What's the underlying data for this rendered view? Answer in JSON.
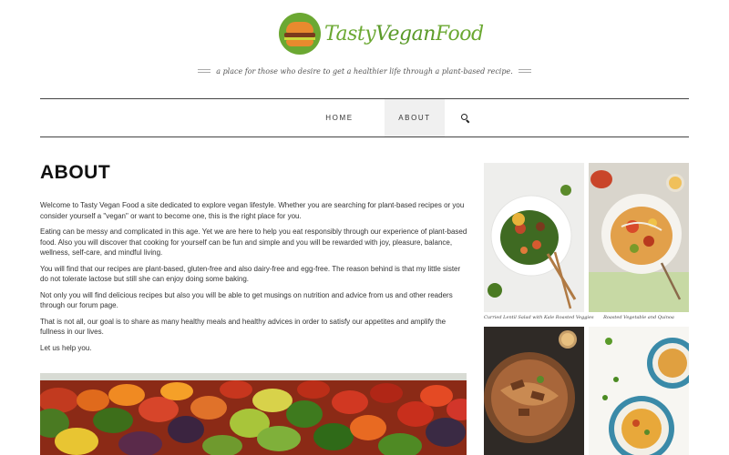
{
  "site": {
    "logo_text_tasty": "Tasty",
    "logo_text_vegan": "Vegan",
    "logo_text_food": "Food",
    "tagline": "a place for those who desire to get a healthier life through a plant-based recipe.",
    "brand_color": "#6ba832"
  },
  "nav": {
    "items": [
      {
        "label": "HOME",
        "active": false
      },
      {
        "label": "ABOUT",
        "active": true
      }
    ],
    "search_icon": "search-icon"
  },
  "main": {
    "title": "ABOUT",
    "paragraphs": [
      "Welcome to Tasty Vegan Food a site dedicated to explore vegan lifestyle. Whether you are searching for plant-based recipes or you consider yourself a \"vegan\" or want to become one, this is the right place for you.",
      "Eating can be messy and complicated in this age. Yet we are here to help you eat responsibly through our experience of plant-based food. Also you will discover that cooking for yourself can be fun and simple and you will be rewarded with joy, pleasure, balance, wellness, self-care, and mindful living.",
      "You will find that our recipes are plant-based, gluten-free and also dairy-free and egg-free. The reason behind is that my little sister do not tolerate lactose but still she can enjoy doing some baking.",
      "Not only you will find delicious recipes but also you will be able to get musings on nutrition and advice from us and other readers through our forum page.",
      "That is not all, our goal is to share as many healthy meals and healthy advices in order to satisfy our appetites and amplify the fullness in our lives.",
      "Let us help you."
    ]
  },
  "sidebar": {
    "tiles": [
      {
        "caption": "Curried Lentil Salad with Kale Roasted Veggies"
      },
      {
        "caption": "Roasted Vegetable and Quinoa"
      },
      {
        "caption": ""
      },
      {
        "caption": ""
      }
    ]
  }
}
